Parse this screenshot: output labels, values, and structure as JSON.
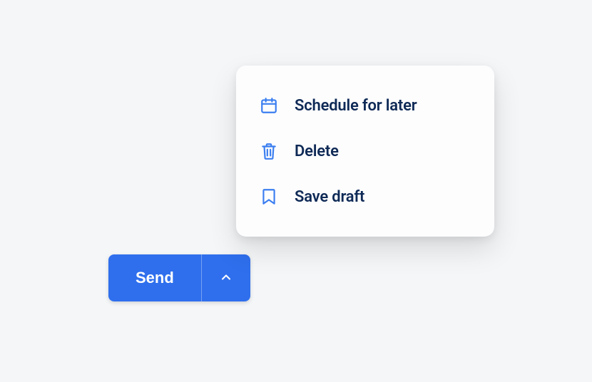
{
  "button": {
    "send_label": "Send"
  },
  "menu": {
    "items": [
      {
        "label": "Schedule for later",
        "icon": "calendar-icon"
      },
      {
        "label": "Delete",
        "icon": "trash-icon"
      },
      {
        "label": "Save draft",
        "icon": "bookmark-icon"
      }
    ]
  },
  "colors": {
    "primary": "#2f6fed",
    "menu_text": "#0f2a56",
    "icon": "#3b7ef0",
    "background": "#f4f6f8"
  }
}
